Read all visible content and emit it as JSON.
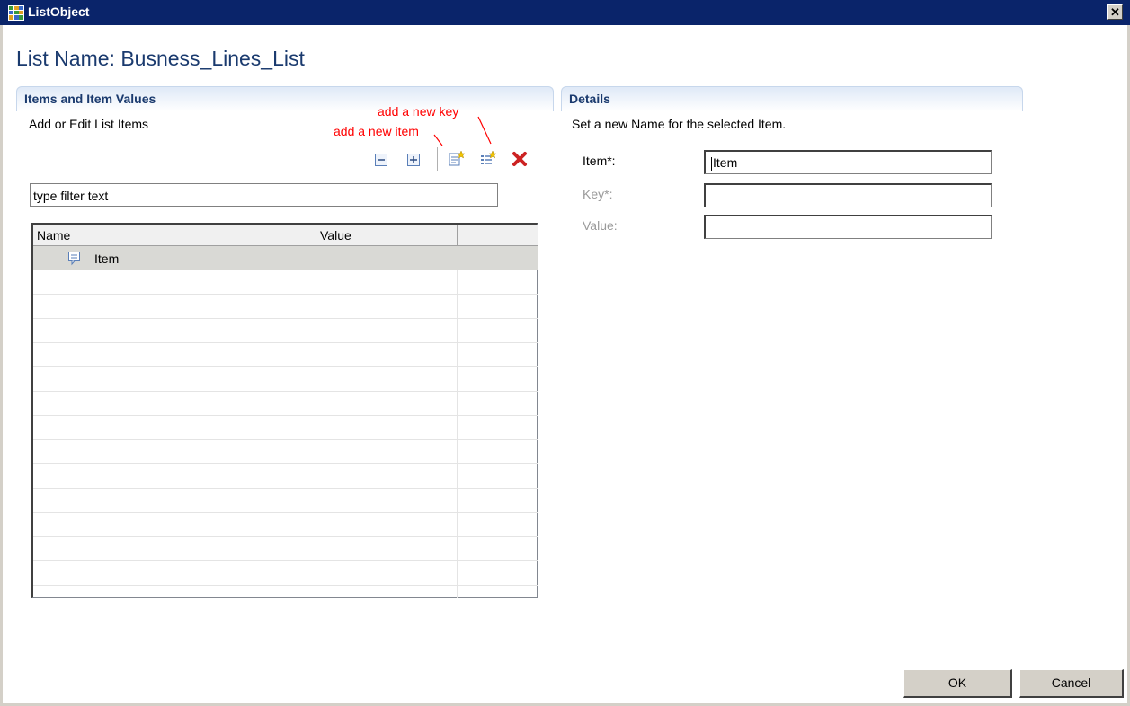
{
  "window": {
    "title": "ListObject",
    "close_label": "✕"
  },
  "page_title": "List Name: Busness_Lines_List",
  "left_section": {
    "title": "Items and Item Values",
    "description": "Add or Edit List Items",
    "annotations": {
      "add_key": "add a new key",
      "add_item": "add a new item"
    },
    "toolbar": [
      "collapse-all-icon",
      "expand-all-icon",
      "add-item-icon",
      "add-key-icon",
      "delete-icon"
    ],
    "filter_value": "type filter text",
    "columns": [
      "Name",
      "Value",
      ""
    ],
    "rows": [
      {
        "name": "Item",
        "value": ""
      }
    ]
  },
  "right_section": {
    "title": "Details",
    "description": "Set a new Name for the selected Item.",
    "fields": [
      {
        "label": "Item*:",
        "value": "Item",
        "enabled": true
      },
      {
        "label": "Key*:",
        "value": "",
        "enabled": false
      },
      {
        "label": "Value:",
        "value": "",
        "enabled": false
      }
    ]
  },
  "buttons": {
    "ok": "OK",
    "cancel": "Cancel"
  },
  "colors": {
    "titlebar": "#0a246a",
    "heading": "#1a3a6e",
    "annotation": "#ff0000",
    "delete": "#cc2222"
  }
}
